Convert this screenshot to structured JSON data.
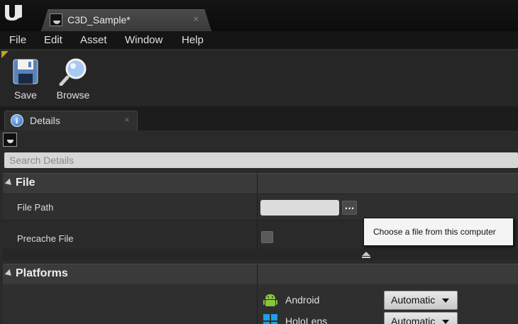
{
  "window": {
    "tab_title": "C3D_Sample*",
    "tab_close": "×"
  },
  "menu": [
    "File",
    "Edit",
    "Asset",
    "Window",
    "Help"
  ],
  "toolbar": {
    "save_label": "Save",
    "browse_label": "Browse"
  },
  "panel": {
    "tab_label": "Details",
    "tab_close": "×"
  },
  "search": {
    "placeholder": "Search Details"
  },
  "categories": {
    "file": "File",
    "platforms": "Platforms"
  },
  "properties": {
    "file_path_label": "File Path",
    "file_path_value": "",
    "browse_button": "...",
    "precache_label": "Precache File",
    "precache_checked": false
  },
  "tooltip": "Choose a file from this computer",
  "platforms": [
    {
      "name": "Android",
      "icon": "android-icon",
      "value": "Automatic"
    },
    {
      "name": "HoloLens",
      "icon": "windows-icon",
      "value": "Automatic"
    }
  ],
  "colors": {
    "accent": "#c8a020",
    "android": "#8bc53f",
    "windows": "#1e9fe8"
  }
}
